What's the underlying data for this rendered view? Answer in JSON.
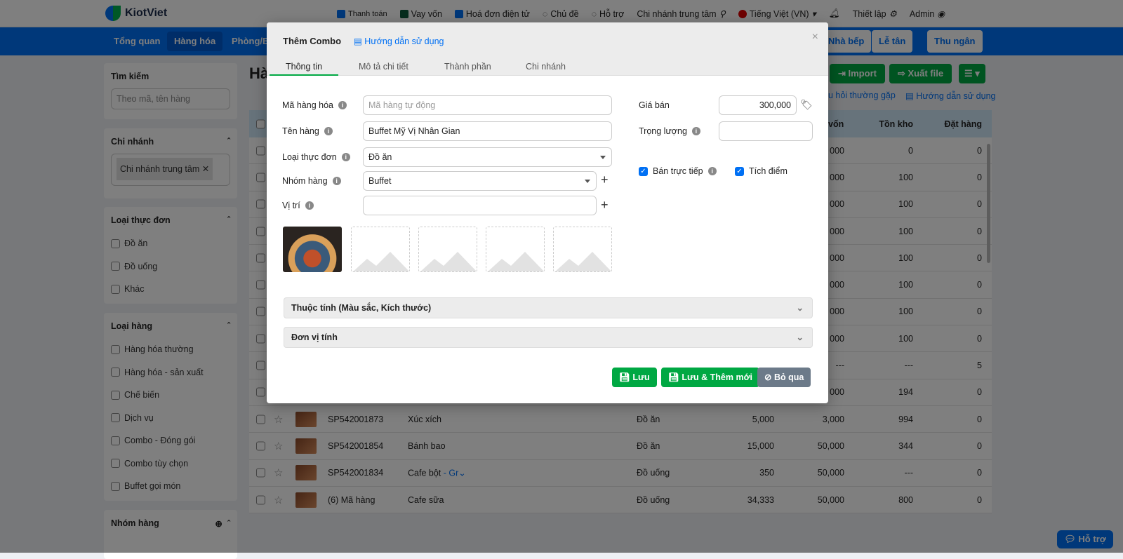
{
  "topbar": {
    "brand": "KiotViet",
    "links": [
      "Thanh toán",
      "Vay vốn",
      "Hoá đơn điện tử",
      "Chủ đề",
      "Hỗ trợ",
      "Chi nhánh trung tâm",
      "Tiếng Việt (VN)",
      "Thiết lập",
      "Admin"
    ]
  },
  "nav": {
    "items": [
      "Tổng quan",
      "Hàng hóa",
      "Phòng/Bà"
    ],
    "active": "Hàng hóa",
    "right_buttons": [
      "Nhà bếp",
      "Lễ tân",
      "Thu ngân"
    ]
  },
  "sidebar": {
    "search": {
      "title": "Tìm kiếm",
      "placeholder": "Theo mã, tên hàng"
    },
    "branch": {
      "title": "Chi nhánh",
      "tag": "Chi nhánh trung tâm"
    },
    "menu_type": {
      "title": "Loại thực đơn",
      "options": [
        "Đồ ăn",
        "Đồ uống",
        "Khác"
      ]
    },
    "item_type": {
      "title": "Loại hàng",
      "options": [
        "Hàng hóa thường",
        "Hàng hóa - sản xuất",
        "Chế biến",
        "Dịch vụ",
        "Combo - Đóng gói",
        "Combo tùy chọn",
        "Buffet gọi món"
      ]
    },
    "group": {
      "title": "Nhóm hàng"
    }
  },
  "main": {
    "title": "Hà",
    "buttons": {
      "import": "Import",
      "export": "Xuất file"
    },
    "links": {
      "faq": "u hỏi thường gặp",
      "guide": "Hướng dẫn sử dụng"
    },
    "columns": {
      "cost": "vốn",
      "stock": "Tồn kho",
      "order": "Đặt hàng"
    },
    "rows": [
      {
        "cost": "000",
        "stock": "0",
        "order": "0"
      },
      {
        "cost": "000",
        "stock": "100",
        "order": "0"
      },
      {
        "cost": "000",
        "stock": "100",
        "order": "0"
      },
      {
        "cost": "000",
        "stock": "100",
        "order": "0"
      },
      {
        "cost": "000",
        "stock": "100",
        "order": "0"
      },
      {
        "cost": "000",
        "stock": "100",
        "order": "0"
      },
      {
        "cost": "000",
        "stock": "100",
        "order": "0"
      },
      {
        "cost": "000",
        "stock": "100",
        "order": "0"
      },
      {
        "cost": "---",
        "stock": "---",
        "order": "5"
      },
      {
        "cost": "000",
        "stock": "194",
        "order": "0"
      },
      {
        "code": "SP542001873",
        "name": "Xúc xích",
        "type": "Đồ ăn",
        "price": "5,000",
        "cost": "3,000",
        "stock": "994",
        "order": "0"
      },
      {
        "code": "SP542001854",
        "name": "Bánh bao",
        "type": "Đồ ăn",
        "price": "15,000",
        "cost": "50,000",
        "stock": "344",
        "order": "0"
      },
      {
        "code": "SP542001834",
        "name": "Cafe bột",
        "variant": "- Gr",
        "type": "Đồ uống",
        "price": "350",
        "cost": "50,000",
        "stock": "---",
        "order": "0"
      },
      {
        "code": "(6) Mã hàng",
        "name": "Cafe sữa",
        "type": "Đồ uống",
        "price": "34,333",
        "cost": "50,000",
        "stock": "800",
        "order": "0"
      }
    ]
  },
  "modal": {
    "title": "Thêm Combo",
    "guide": "Hướng dẫn sử dụng",
    "close": "×",
    "tabs": [
      "Thông tin",
      "Mô tả chi tiết",
      "Thành phần",
      "Chi nhánh"
    ],
    "fields": {
      "code": {
        "label": "Mã hàng hóa",
        "placeholder": "Mã hàng tự động"
      },
      "name": {
        "label": "Tên hàng",
        "value": "Buffet Mỹ Vị Nhân Gian"
      },
      "menu_type": {
        "label": "Loại thực đơn",
        "value": "Đồ ăn"
      },
      "group": {
        "label": "Nhóm hàng",
        "value": "Buffet"
      },
      "location": {
        "label": "Vị trí",
        "value": ""
      },
      "price": {
        "label": "Giá bán",
        "value": "300,000"
      },
      "weight": {
        "label": "Trọng lượng",
        "value": ""
      },
      "direct_sale": {
        "label": "Bán trực tiếp",
        "checked": true
      },
      "points": {
        "label": "Tích điểm",
        "checked": true
      }
    },
    "sections": [
      "Thuộc tính (Màu sắc, Kích thước)",
      "Đơn vị tính"
    ],
    "buttons": {
      "save": "Lưu",
      "save_new": "Lưu & Thêm mới",
      "cancel": "Bỏ qua"
    }
  },
  "help": "Hỗ trợ",
  "colors": {
    "primary": "#0070f4",
    "green": "#00a843",
    "gray_btn": "#6c7a89"
  }
}
